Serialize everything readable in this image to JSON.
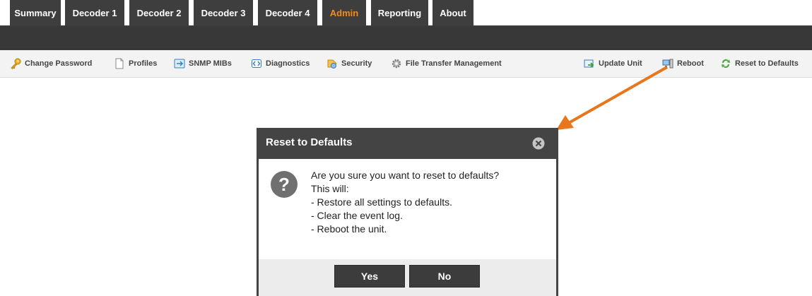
{
  "tabs": [
    {
      "label": "Summary",
      "active": false
    },
    {
      "label": "Decoder 1",
      "active": false
    },
    {
      "label": "Decoder 2",
      "active": false
    },
    {
      "label": "Decoder 3",
      "active": false
    },
    {
      "label": "Decoder 4",
      "active": false
    },
    {
      "label": "Admin",
      "active": true
    },
    {
      "label": "Reporting",
      "active": false
    },
    {
      "label": "About",
      "active": false
    }
  ],
  "toolbar": {
    "left": [
      {
        "label": "Change Password",
        "icon": "key-icon"
      },
      {
        "label": "Profiles",
        "icon": "document-icon"
      },
      {
        "label": "SNMP MIBs",
        "icon": "snmp-icon"
      },
      {
        "label": "Diagnostics",
        "icon": "diagnostics-icon"
      },
      {
        "label": "Security",
        "icon": "security-icon"
      },
      {
        "label": "File Transfer Management",
        "icon": "gear-icon"
      }
    ],
    "right": [
      {
        "label": "Update Unit",
        "icon": "update-icon"
      },
      {
        "label": "Reboot",
        "icon": "computer-icon"
      },
      {
        "label": "Reset to Defaults",
        "icon": "reset-arrows-icon"
      }
    ]
  },
  "dialog": {
    "title": "Reset to Defaults",
    "message_lines": [
      "Are you sure you want to reset to defaults?",
      "This will:",
      "- Restore all settings to defaults.",
      "- Clear the event log.",
      "- Reboot the unit."
    ],
    "yes_label": "Yes",
    "no_label": "No"
  },
  "colors": {
    "active_tab_text": "#f28c1e",
    "tab_background": "#3e3e3e",
    "arrow": "#e8761c"
  }
}
